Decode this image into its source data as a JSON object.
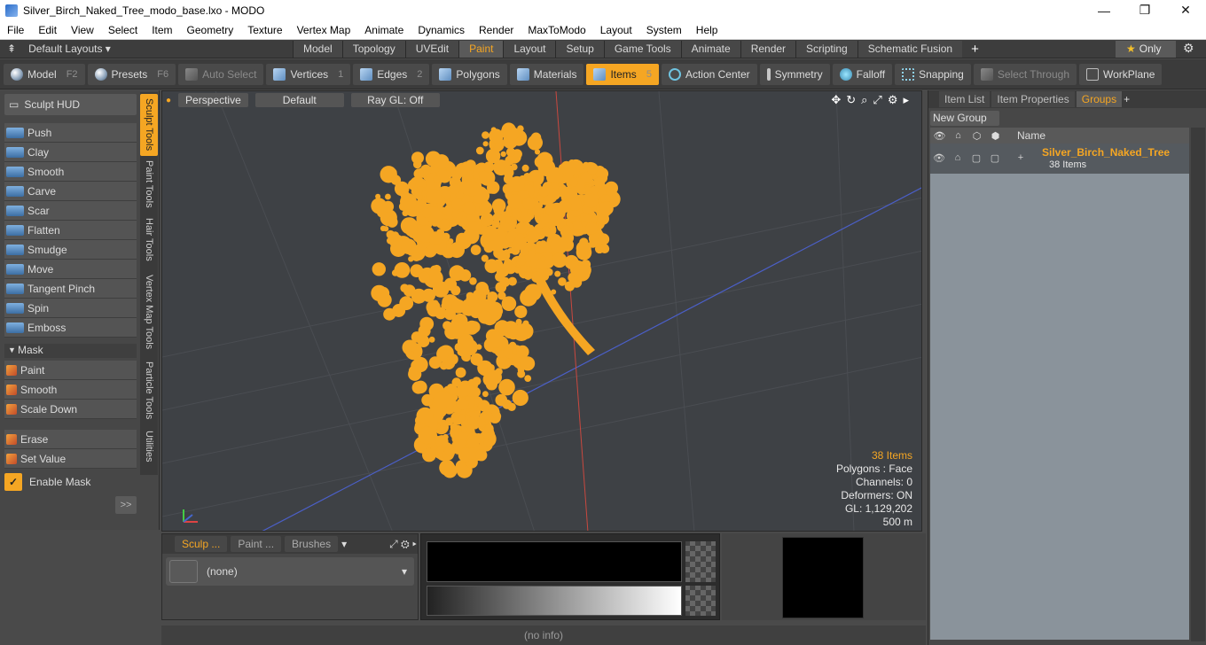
{
  "window": {
    "title": "Silver_Birch_Naked_Tree_modo_base.lxo - MODO",
    "minimize": "—",
    "maximize": "❐",
    "close": "✕"
  },
  "menu": [
    "File",
    "Edit",
    "View",
    "Select",
    "Item",
    "Geometry",
    "Texture",
    "Vertex Map",
    "Animate",
    "Dynamics",
    "Render",
    "MaxToModo",
    "Layout",
    "System",
    "Help"
  ],
  "layouts": {
    "label": "Default Layouts ▾",
    "tabs": [
      "Model",
      "Topology",
      "UVEdit",
      "Paint",
      "Layout",
      "Setup",
      "Game Tools",
      "Animate",
      "Render",
      "Scripting",
      "Schematic Fusion"
    ],
    "active_tab": "Paint",
    "only": "Only"
  },
  "toolbar": {
    "model": "Model",
    "model_key": "F2",
    "presets": "Presets",
    "presets_key": "F6",
    "auto_select": "Auto Select",
    "vertices": "Vertices",
    "vertices_key": "1",
    "edges": "Edges",
    "edges_key": "2",
    "polygons": "Polygons",
    "materials": "Materials",
    "items": "Items",
    "items_key": "5",
    "action_center": "Action Center",
    "symmetry": "Symmetry",
    "falloff": "Falloff",
    "snapping": "Snapping",
    "select_through": "Select Through",
    "workplane": "WorkPlane"
  },
  "left": {
    "sculpt_hud": "Sculpt HUD",
    "tools": [
      "Push",
      "Clay",
      "Smooth",
      "Carve",
      "Scar",
      "Flatten",
      "Smudge",
      "Move",
      "Tangent Pinch",
      "Spin",
      "Emboss"
    ],
    "mask_label": "Mask",
    "mask_tools": [
      "Paint",
      "Smooth",
      "Scale Down"
    ],
    "erase_tools": [
      "Erase",
      "Set Value"
    ],
    "enable_mask": "Enable Mask",
    "expand": ">>",
    "vtabs": [
      "Sculpt Tools",
      "Paint Tools",
      "Hair Tools",
      "Vertex Map Tools",
      "Particle Tools",
      "Utilities"
    ]
  },
  "viewport": {
    "view": "Perspective",
    "shading": "Default",
    "raygl": "Ray GL: Off",
    "stats": {
      "items": "38 Items",
      "polygons": "Polygons : Face",
      "channels": "Channels: 0",
      "deformers": "Deformers: ON",
      "gl": "GL: 1,129,202",
      "scale": "500 m"
    },
    "tree_color": "#f5a623"
  },
  "bottom": {
    "tabs": [
      "Sculp ...",
      "Paint ...",
      "Brushes"
    ],
    "brush_value": "(none)",
    "status": "(no info)"
  },
  "right": {
    "tabs": [
      "Item List",
      "Item Properties",
      "Groups"
    ],
    "active_tab": "Groups",
    "new_group": "New Group",
    "name_header": "Name",
    "group_name": "Silver_Birch_Naked_Tree",
    "group_count": "38 Items"
  },
  "colors": {
    "accent": "#f5a623",
    "panel": "#474747",
    "viewport": "#3e4145"
  }
}
